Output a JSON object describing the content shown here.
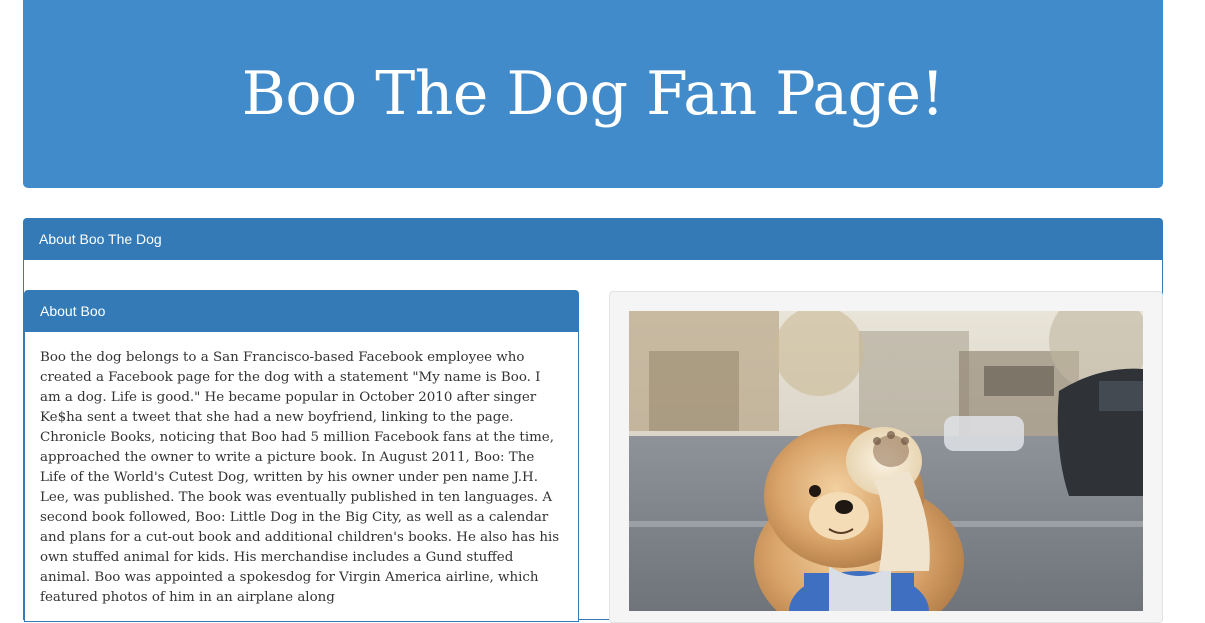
{
  "header": {
    "title": "Boo The Dog Fan Page!"
  },
  "outer_panel": {
    "title": "About Boo The Dog"
  },
  "about_panel": {
    "title": "About Boo",
    "body": "Boo the dog belongs to a San Francisco-based Facebook employee who created a Facebook page for the dog with a statement \"My name is Boo. I am a dog. Life is good.\" He became popular in October 2010 after singer Ke$ha sent a tweet that she had a new boyfriend, linking to the page. Chronicle Books, noticing that Boo had 5 million Facebook fans at the time, approached the owner to write a picture book. In August 2011, Boo: The Life of the World's Cutest Dog, written by his owner under pen name J.H. Lee, was published. The book was eventually published in ten languages. A second book followed, Boo: Little Dog in the Big City, as well as a calendar and plans for a cut-out book and additional children's books. He also has his own stuffed animal for kids. His merchandise includes a Gund stuffed animal. Boo was appointed a spokesdog for Virgin America airline, which featured photos of him in an airplane along"
  },
  "photo": {
    "subject": "pomeranian-dog-photo"
  }
}
